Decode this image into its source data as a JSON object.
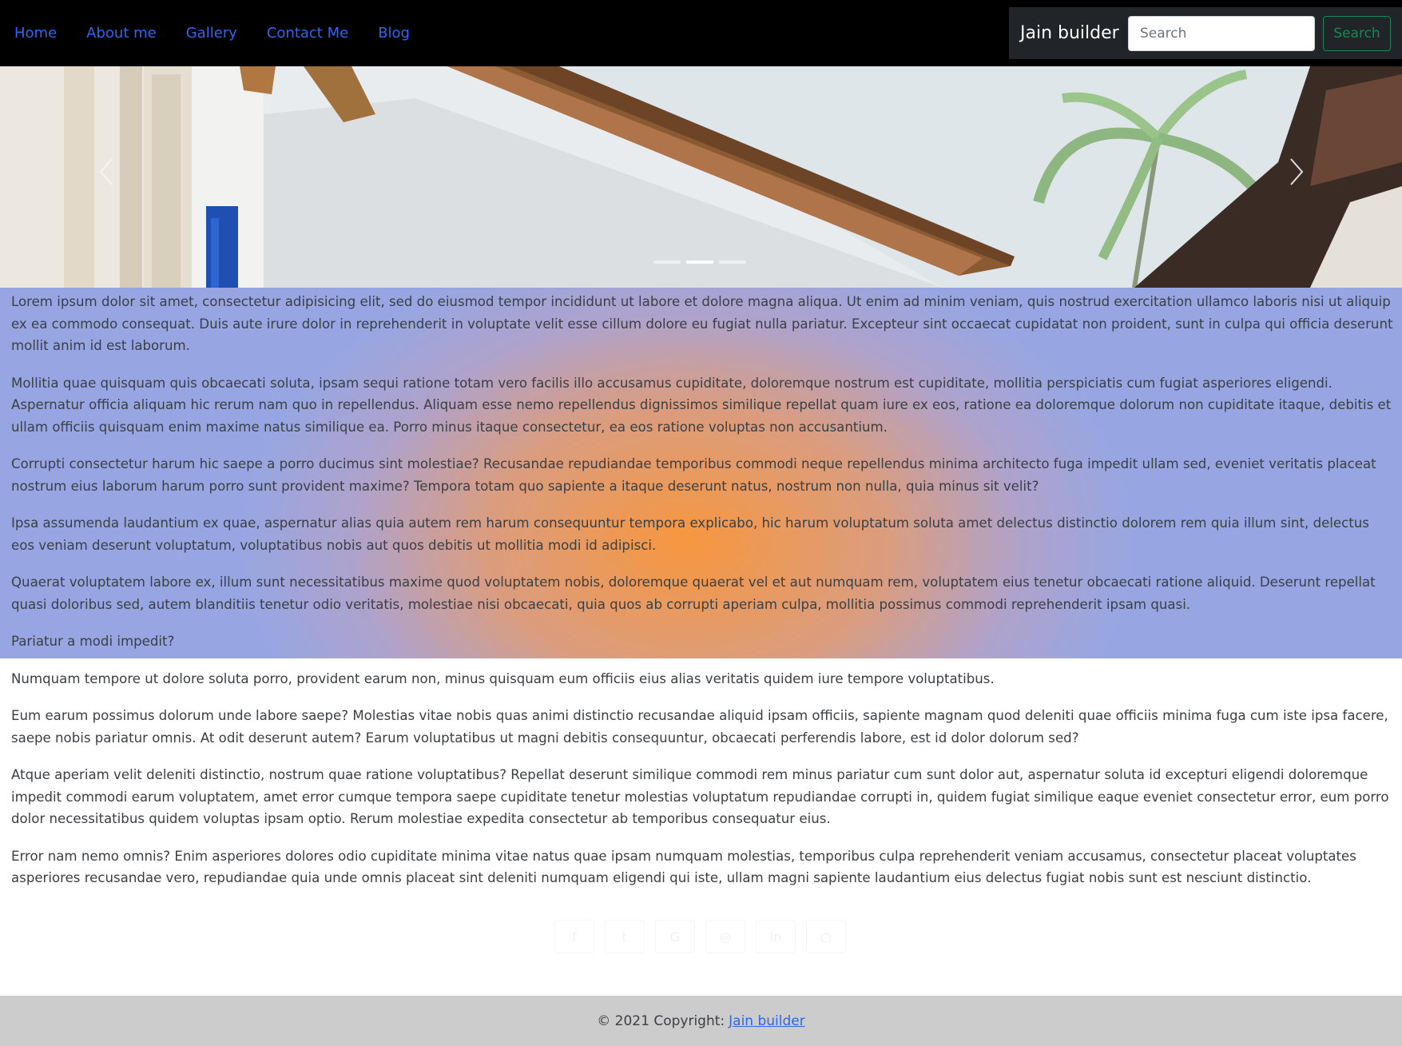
{
  "nav": {
    "links": [
      "Home",
      "About me",
      "Gallery",
      "Contact Me",
      "Blog"
    ],
    "brand": "Jain builder",
    "search_placeholder": "Search",
    "search_button": "Search"
  },
  "carousel": {
    "slide_count": 3,
    "active_index": 1
  },
  "content": {
    "paragraphs": [
      "Lorem ipsum dolor sit amet, consectetur adipisicing elit, sed do eiusmod tempor incididunt ut labore et dolore magna aliqua. Ut enim ad minim veniam, quis nostrud exercitation ullamco laboris nisi ut aliquip ex ea commodo consequat. Duis aute irure dolor in reprehenderit in voluptate velit esse cillum dolore eu fugiat nulla pariatur. Excepteur sint occaecat cupidatat non proident, sunt in culpa qui officia deserunt mollit anim id est laborum.",
      "Mollitia quae quisquam quis obcaecati soluta, ipsam sequi ratione totam vero facilis illo accusamus cupiditate, doloremque nostrum est cupiditate, mollitia perspiciatis cum fugiat asperiores eligendi. Aspernatur officia aliquam hic rerum nam quo in repellendus. Aliquam esse nemo repellendus dignissimos similique repellat quam iure ex eos, ratione ea doloremque dolorum non cupiditate itaque, debitis et ullam officiis quisquam enim maxime natus similique ea. Porro minus itaque consectetur, ea eos ratione voluptas non accusantium.",
      "Corrupti consectetur harum hic saepe a porro ducimus sint molestiae? Recusandae repudiandae temporibus commodi neque repellendus minima architecto fuga impedit ullam sed, eveniet veritatis placeat nostrum eius laborum harum porro sunt provident maxime? Tempora totam quo sapiente a itaque deserunt natus, nostrum non nulla, quia minus sit velit?",
      "Ipsa assumenda laudantium ex quae, aspernatur alias quia autem rem harum consequuntur tempora explicabo, hic harum voluptatum soluta amet delectus distinctio dolorem rem quia illum sint, delectus eos veniam deserunt voluptatum, voluptatibus nobis aut quos debitis ut mollitia modi id adipisci.",
      "Quaerat voluptatem labore ex, illum sunt necessitatibus maxime quod voluptatem nobis, doloremque quaerat vel et aut numquam rem, voluptatem eius tenetur obcaecati ratione aliquid. Deserunt repellat quasi doloribus sed, autem blanditiis tenetur odio veritatis, molestiae nisi obcaecati, quia quos ab corrupti aperiam culpa, mollitia possimus commodi reprehenderit ipsam quasi.",
      "Pariatur a modi impedit?",
      "Numquam tempore ut dolore soluta porro, provident earum non, minus quisquam eum officiis eius alias veritatis quidem iure tempore voluptatibus.",
      "Eum earum possimus dolorum unde labore saepe? Molestias vitae nobis quas animi distinctio recusandae aliquid ipsam officiis, sapiente magnam quod deleniti quae officiis minima fuga cum iste ipsa facere, saepe nobis pariatur omnis. At odit deserunt autem? Earum voluptatibus ut magni debitis consequuntur, obcaecati perferendis labore, est id dolor dolorum sed?",
      "Atque aperiam velit deleniti distinctio, nostrum quae ratione voluptatibus? Repellat deserunt similique commodi rem minus pariatur cum sunt dolor aut, aspernatur soluta id excepturi eligendi doloremque impedit commodi earum voluptatem, amet error cumque tempora saepe cupiditate tenetur molestias voluptatum repudiandae corrupti in, quidem fugiat similique eaque eveniet consectetur error, eum porro dolor necessitatibus quidem voluptas ipsam optio. Rerum molestiae expedita consectetur ab temporibus consequatur eius.",
      "Error nam nemo omnis? Enim asperiores dolores odio cupiditate minima vitae natus quae ipsam numquam molestias, temporibus culpa reprehenderit veniam accusamus, consectetur placeat voluptates asperiores recusandae vero, repudiandae quia unde omnis placeat sint deleniti numquam eligendi qui iste, ullam magni sapiente laudantium eius delectus fugiat nobis sunt est nesciunt distinctio."
    ]
  },
  "social": {
    "icons": [
      "facebook-icon",
      "twitter-icon",
      "google-icon",
      "instagram-icon",
      "linkedin-icon",
      "github-icon"
    ],
    "glyphs": [
      "f",
      "t",
      "G",
      "◎",
      "in",
      "○"
    ]
  },
  "footer": {
    "copyright": "© 2021 Copyright:",
    "link": "Jain builder"
  },
  "colors": {
    "nav_bg": "#000000",
    "nav_link": "#2f66ea",
    "brand_bg": "#212529",
    "search_button": "#198754",
    "gradient_center": "#f7973f",
    "gradient_edge": "#97a6e2",
    "footer_bg": "#cccccc"
  }
}
